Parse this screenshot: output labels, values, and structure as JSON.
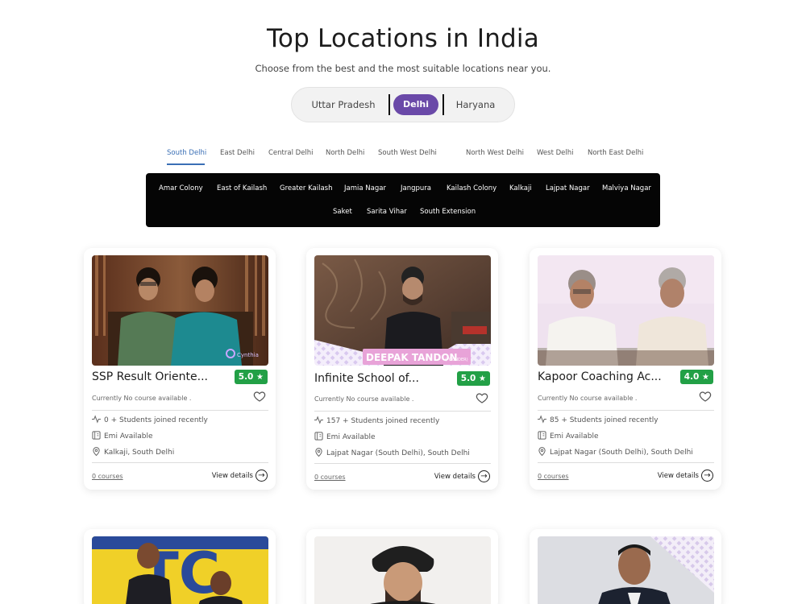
{
  "header": {
    "title": "Top Locations in India",
    "subtitle": "Choose from the best and the most suitable locations near you."
  },
  "states": [
    "Uttar Pradesh",
    "Delhi",
    "Haryana"
  ],
  "selected_state": "Delhi",
  "districts": [
    "South Delhi",
    "East Delhi",
    "Central Delhi",
    "North Delhi",
    "South West Delhi",
    "North West Delhi",
    "West Delhi",
    "North East Delhi"
  ],
  "selected_district": "South Delhi",
  "areas": [
    "Amar Colony",
    "East of Kailash",
    "Greater Kailash",
    "Jamia Nagar",
    "Jangpura",
    "Kailash Colony",
    "Kalkaji",
    "Lajpat Nagar",
    "Malviya Nagar",
    "Saket",
    "Sarita Vihar",
    "South Extension"
  ],
  "cards": [
    {
      "name": "SSP Result Oriente...",
      "rating": "5.0",
      "status": "Currently No course available .",
      "students": "0 + Students joined recently",
      "emi": "Emi Available",
      "location": "Kalkaji, South Delhi",
      "courses": "0 courses",
      "view": "View details",
      "image_watermark": "Cynthia"
    },
    {
      "name": "Infinite School of...",
      "rating": "5.0",
      "status": "Currently No course available .",
      "students": "157 + Students joined recently",
      "emi": "Emi Available",
      "location": "Lajpat Nagar (South Delhi), South Delhi",
      "courses": "0 courses",
      "view": "View details",
      "image_banner": "DEEPAK TANDON",
      "image_banner_sub": "(FOUNDER)"
    },
    {
      "name": "Kapoor Coaching Ac...",
      "rating": "4.0",
      "status": "Currently No course available .",
      "students": "85 + Students joined recently",
      "emi": "Emi Available",
      "location": "Lajpat Nagar (South Delhi), South Delhi",
      "courses": "0 courses",
      "view": "View details"
    }
  ],
  "colors": {
    "accent_purple": "#6a49a8",
    "tab_blue": "#3a6fb5",
    "rating_green": "#22a046",
    "panel_black": "#050505"
  }
}
